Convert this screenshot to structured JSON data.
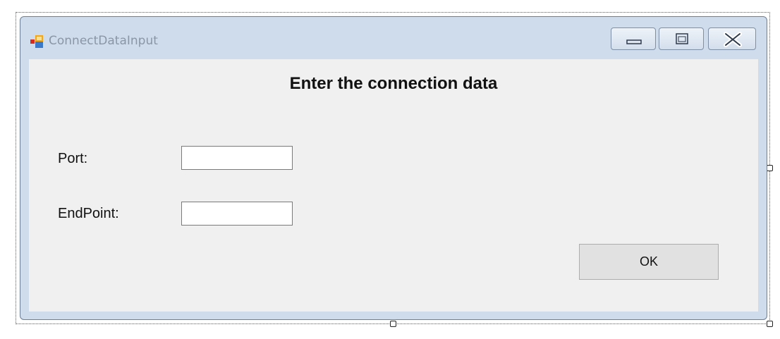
{
  "window": {
    "title": "ConnectDataInput",
    "icon": "windows-form-icon",
    "controls": {
      "minimize_icon": "minimize-icon",
      "maximize_icon": "maximize-icon",
      "close_icon": "close-icon"
    }
  },
  "form": {
    "heading": "Enter the connection data",
    "port_label": "Port:",
    "port_value": "",
    "endpoint_label": "EndPoint:",
    "endpoint_value": "",
    "ok_label": "OK"
  },
  "colors": {
    "frame": "#cfdcec",
    "client_background": "#f0f0f0",
    "button_background": "#e1e1e1"
  }
}
